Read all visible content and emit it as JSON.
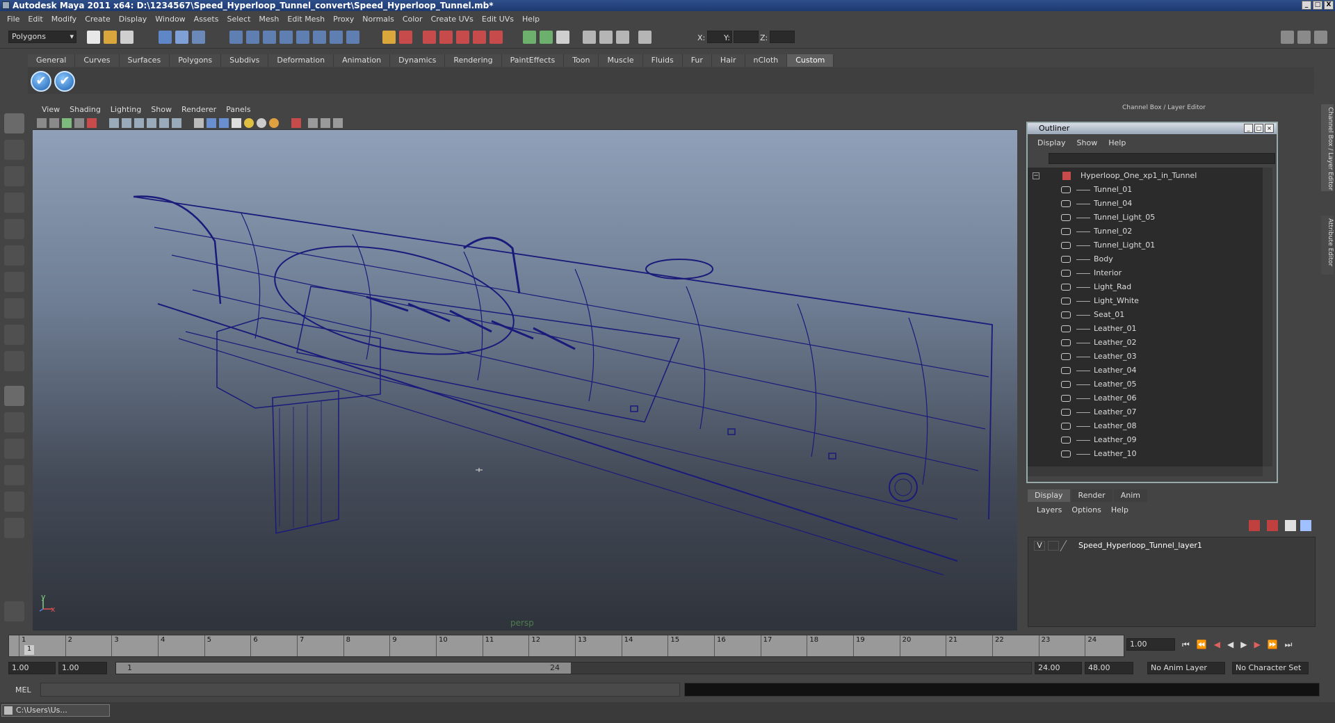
{
  "window": {
    "title": "Autodesk Maya 2011 x64: D:\\1234567\\Speed_Hyperloop_Tunnel_convert\\Speed_Hyperloop_Tunnel.mb*",
    "controls": [
      "_",
      "□",
      "X"
    ]
  },
  "menubar": [
    "File",
    "Edit",
    "Modify",
    "Create",
    "Display",
    "Window",
    "Assets",
    "Select",
    "Mesh",
    "Edit Mesh",
    "Proxy",
    "Normals",
    "Color",
    "Create UVs",
    "Edit UVs",
    "Help"
  ],
  "statusline": {
    "menu_set": "Polygons",
    "coord_labels": [
      "X:",
      "Y:",
      "Z:"
    ]
  },
  "shelf": {
    "tabs": [
      "General",
      "Curves",
      "Surfaces",
      "Polygons",
      "Subdivs",
      "Deformation",
      "Animation",
      "Dynamics",
      "Rendering",
      "PaintEffects",
      "Toon",
      "Muscle",
      "Fluids",
      "Fur",
      "Hair",
      "nCloth",
      "Custom"
    ],
    "active_tab": "Custom",
    "buttons": [
      "✔",
      "✔"
    ]
  },
  "viewport": {
    "menu": [
      "View",
      "Shading",
      "Lighting",
      "Show",
      "Renderer",
      "Panels"
    ],
    "camera_label": "persp",
    "axis_x": "x",
    "axis_y": "y",
    "wire_color": "#1a1a7a"
  },
  "channel_box_title": "Channel Box / Layer Editor",
  "side_tabs": [
    "Channel Box / Layer Editor",
    "Attribute Editor"
  ],
  "outliner": {
    "title": "Outliner",
    "menu": [
      "Display",
      "Show",
      "Help"
    ],
    "root": "Hyperloop_One_xp1_in_Tunnel",
    "items": [
      "Tunnel_01",
      "Tunnel_04",
      "Tunnel_Light_05",
      "Tunnel_02",
      "Tunnel_Light_01",
      "Body",
      "Interior",
      "Light_Rad",
      "Light_White",
      "Seat_01",
      "Leather_01",
      "Leather_02",
      "Leather_03",
      "Leather_04",
      "Leather_05",
      "Leather_06",
      "Leather_07",
      "Leather_08",
      "Leather_09",
      "Leather_10"
    ]
  },
  "layer_editor": {
    "tabs": [
      "Display",
      "Render",
      "Anim"
    ],
    "active_tab": "Display",
    "menu": [
      "Layers",
      "Options",
      "Help"
    ],
    "layer_visibility": "V",
    "layer_name": "Speed_Hyperloop_Tunnel_layer1"
  },
  "timeline": {
    "ticks": [
      "1",
      "2",
      "3",
      "4",
      "5",
      "6",
      "7",
      "8",
      "9",
      "10",
      "11",
      "12",
      "13",
      "14",
      "15",
      "16",
      "17",
      "18",
      "19",
      "20",
      "21",
      "22",
      "23",
      "24"
    ],
    "current_frame_marker": "1",
    "current_time": "1.00"
  },
  "range": {
    "start": "1.00",
    "playback_start": "1.00",
    "slider_start": "1",
    "slider_end": "24",
    "playback_end": "24.00",
    "end": "48.00",
    "anim_layer": "No Anim Layer",
    "character_set": "No Character Set"
  },
  "command_line": {
    "language": "MEL"
  },
  "taskbar": {
    "item": "C:\\Users\\Us..."
  }
}
